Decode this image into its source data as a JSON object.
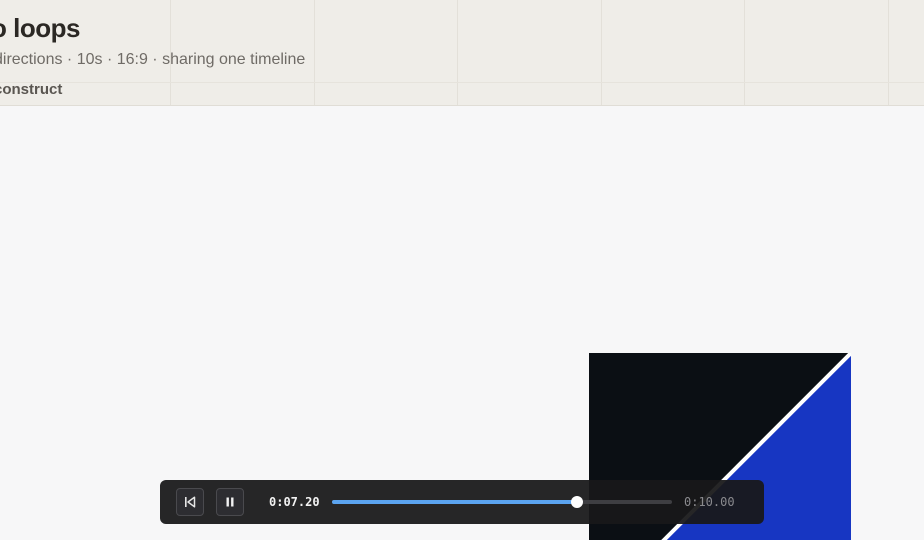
{
  "header": {
    "title": "o loops",
    "subtitle": "directions · 10s · 16:9 · sharing one timeline",
    "crumb": "construct"
  },
  "player": {
    "current_time": "0:07.20",
    "duration": "0:10.00",
    "progress": 0.72,
    "restart_icon": "skip-to-start-icon",
    "pause_icon": "pause-icon",
    "track_color": "#3e3e42",
    "fill_color": "#5ba4f0"
  },
  "stage": {
    "colors": {
      "dark": "#0b0f14",
      "blue": "#1736c2",
      "stripe": "#ffffff"
    }
  }
}
